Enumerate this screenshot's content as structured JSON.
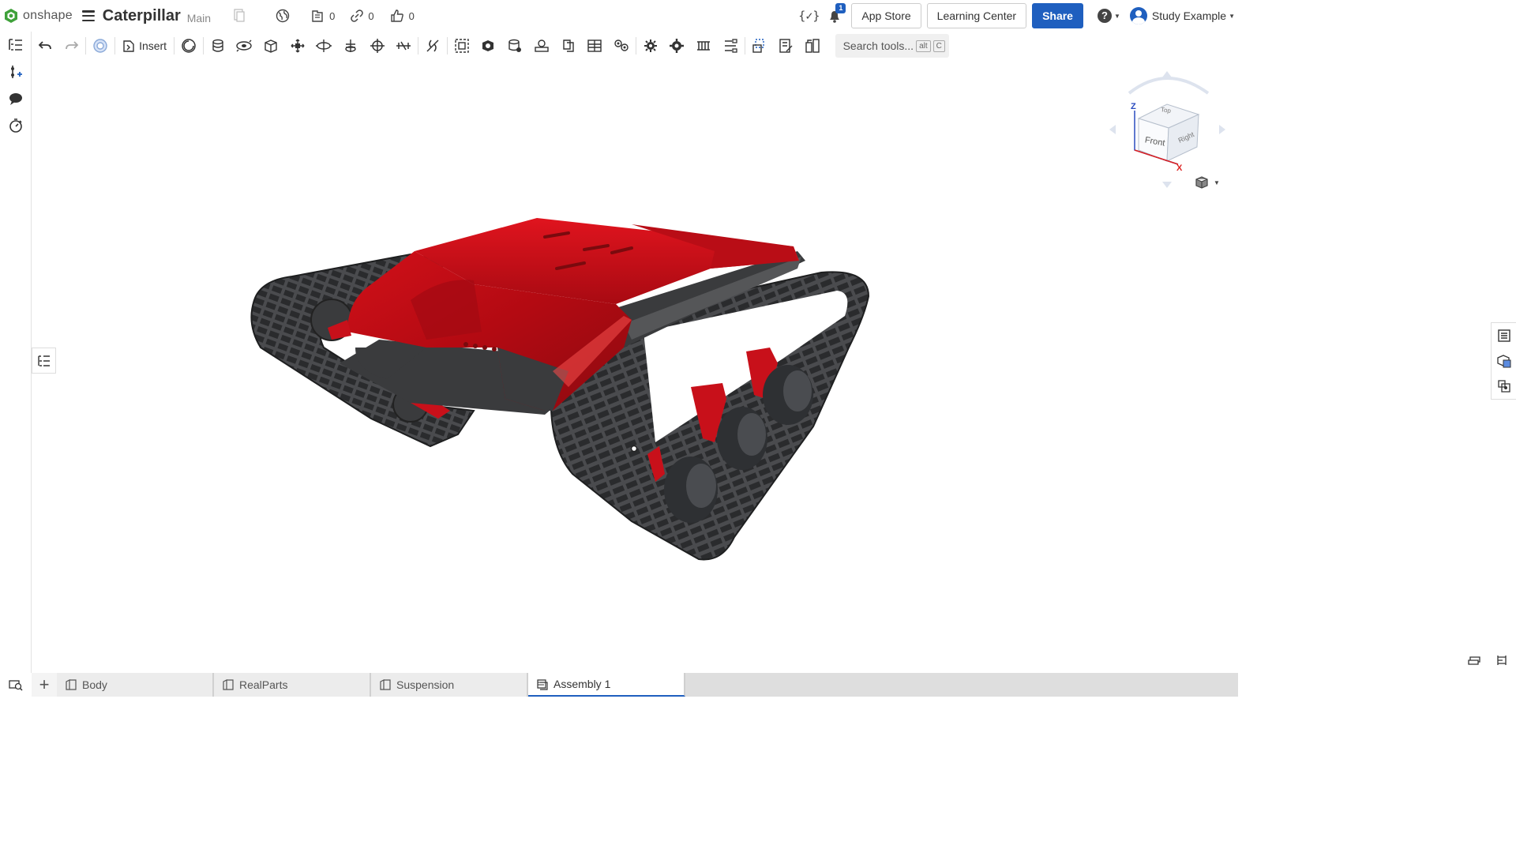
{
  "header": {
    "logo_text": "onshape",
    "doc_title": "Caterpillar",
    "branch": "Main",
    "versions_count": "0",
    "links_count": "0",
    "likes_count": "0",
    "variables_icon": "{✓}",
    "notification_count": "1",
    "app_store_label": "App Store",
    "learning_center_label": "Learning Center",
    "share_label": "Share",
    "help_label": "?",
    "user_name": "Study Example"
  },
  "toolbar": {
    "insert_label": "Insert",
    "search_label": "Search tools...",
    "search_kbd1": "alt",
    "search_kbd2": "C"
  },
  "viewcube": {
    "front": "Front",
    "right": "Right",
    "top": "Top",
    "axis_z": "Z",
    "axis_x": "X"
  },
  "tabs": [
    {
      "label": "Body",
      "active": false
    },
    {
      "label": "RealParts",
      "active": false
    },
    {
      "label": "Suspension",
      "active": false
    },
    {
      "label": "Assembly 1",
      "active": true
    }
  ],
  "colors": {
    "brand": "#1f5fbf",
    "model_red": "#c8101a",
    "track_dark": "#3a3b3d"
  }
}
